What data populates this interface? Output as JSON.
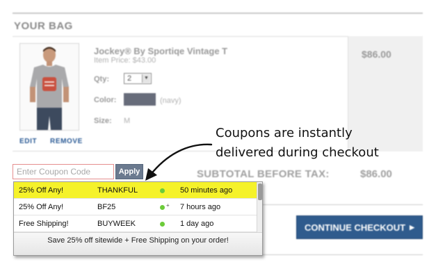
{
  "bag": {
    "title": "YOUR BAG"
  },
  "item": {
    "name": "Jockey® By Sportiqe Vintage T",
    "item_price": "Item Price: $43.00",
    "qty_label": "Qty:",
    "qty_value": "2",
    "color_label": "Color:",
    "color_name": "(navy)",
    "size_label": "Size:",
    "size_value": "M",
    "line_price": "$86.00",
    "edit_label": "EDIT",
    "remove_label": "REMOVE",
    "swatch_color": "#676c7a"
  },
  "coupon": {
    "placeholder": "Enter Coupon Code",
    "apply_label": "Apply"
  },
  "subtotal": {
    "label": "SUBTOTAL BEFORE TAX:",
    "value": "$86.00"
  },
  "checkout": {
    "label": "CONTINUE CHECKOUT",
    "arrow_icon": "triangle-right-icon"
  },
  "annotation": {
    "line1": "Coupons are instantly",
    "line2": "delivered during checkout"
  },
  "dropdown": {
    "rows": [
      {
        "offer": "25% Off Any!",
        "code": "THANKFUL",
        "time": "50 minutes ago",
        "highlighted": true,
        "plus": ""
      },
      {
        "offer": "25% Off Any!",
        "code": "BF25",
        "time": "7 hours ago",
        "highlighted": false,
        "plus": "+"
      },
      {
        "offer": "Free Shipping!",
        "code": "BUYWEEK",
        "time": "1 day ago",
        "highlighted": false,
        "plus": ""
      }
    ],
    "footer": "Save 25% off sitewide + Free Shipping on your order!"
  },
  "colors": {
    "highlight": "#f5f22a",
    "status_dot": "#6ccb3a",
    "checkout_button": "#2f5b8d",
    "coupon_border": "#e58e8e"
  }
}
